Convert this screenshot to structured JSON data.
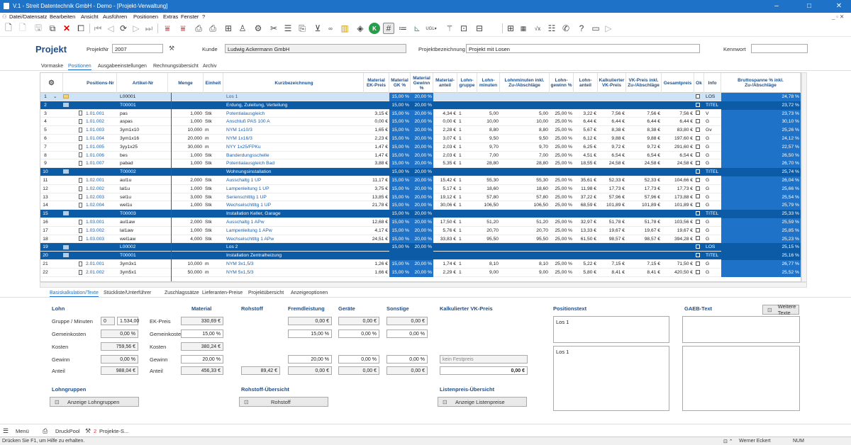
{
  "window": {
    "title": "V.1 - Streit Datentechnik GmbH - Demo - [Projekt-Verwaltung]",
    "controls": [
      "–",
      "□",
      "✕"
    ],
    "mdi_controls": "_ ▫ ✕"
  },
  "menu": [
    "Datei/Datensatz",
    "Bearbeiten",
    "Ansicht",
    "Ausführen",
    "Positionen",
    "Extras",
    "Fenster",
    "?"
  ],
  "header": {
    "title": "Projekt",
    "projektnr_label": "ProjektNr",
    "projektnr_value": "2007",
    "kunde_label": "Kunde",
    "kunde_value": "Ludwig Ackermann GmbH",
    "bezeichnung_label": "Projektbezeichnung",
    "bezeichnung_value": "Projekt mit Losen",
    "kennwort_label": "Kennwort",
    "kennwort_value": ""
  },
  "tabs1": [
    "Vormaske",
    "Positionen",
    "Ausgabeeinstellungen",
    "Rechnungsübersicht",
    "Archiv"
  ],
  "grid": {
    "headers": [
      "Positions-Nr",
      "Artikel-Nr",
      "Menge",
      "Einheit",
      "Kurzbezeichnung",
      "Material EK-Preis",
      "Material GK %",
      "Material Gewinn %",
      "Material-anteil",
      "Lohn-gruppe",
      "Lohn-minuten",
      "Lohnminuten inkl. Zu-/Abschläge",
      "Lohn-gewinn %",
      "Lohn-anteil",
      "Kalkulierter VK-Preis",
      "VK-Preis inkl. Zu-/Abschläge",
      "Gesamtpreis",
      "Ok",
      "Info",
      "Bruttospanne % inkl. Zu-/Abschläge"
    ],
    "rows": [
      {
        "n": "1",
        "type": "sel",
        "pos": "",
        "art": "L00001",
        "menge": "",
        "einh": "",
        "kurz": "Los 1",
        "mek": "",
        "mgk": "15,00 %",
        "mgw": "20,00 %",
        "mant": "",
        "lg": "",
        "lmin": "",
        "lminz": "",
        "lgw": "",
        "lant": "",
        "kvk": "",
        "vkz": "",
        "ges": "",
        "ok": "☑",
        "info": "LOS",
        "bs": "24,78 %"
      },
      {
        "n": "2",
        "type": "title",
        "pos": "",
        "art": "T00001",
        "menge": "",
        "einh": "",
        "kurz": "Erdung, Zuleitung, Verteilung",
        "mek": "",
        "mgk": "15,00 %",
        "mgw": "20,00 %",
        "mant": "",
        "lg": "",
        "lmin": "",
        "lminz": "",
        "lgw": "",
        "lant": "",
        "kvk": "",
        "vkz": "",
        "ges": "",
        "ok": "☑",
        "info": "TITEL",
        "bs": "23,72 %"
      },
      {
        "n": "3",
        "type": "item",
        "pos": "1.01.001",
        "art": "pas",
        "menge": "1,000",
        "einh": "Stk",
        "kurz": "Potentialausgleich",
        "mek": "3,15 €",
        "mgk": "15,00 %",
        "mgw": "20,00 %",
        "mant": "4,34 €",
        "lg": "1",
        "lmin": "5,00",
        "lminz": "5,00",
        "lgw": "25,00 %",
        "lant": "3,22 €",
        "kvk": "7,56 €",
        "vkz": "7,56 €",
        "ges": "7,56 €",
        "ok": "☑",
        "info": "V",
        "bs": "23,73 %"
      },
      {
        "n": "4",
        "type": "item",
        "pos": "1.01.002",
        "art": "aspas",
        "menge": "1,000",
        "einh": "Stk",
        "kurz": "Anschluß PAS 100 A",
        "mek": "0,00 €",
        "mgk": "15,00 %",
        "mgw": "20,00 %",
        "mant": "0,00 €",
        "lg": "1",
        "lmin": "10,00",
        "lminz": "10,00",
        "lgw": "25,00 %",
        "lant": "6,44 €",
        "kvk": "6,44 €",
        "vkz": "6,44 €",
        "ges": "6,44 €",
        "ok": "☑",
        "info": "G",
        "bs": "30,10 %"
      },
      {
        "n": "5",
        "type": "item",
        "pos": "1.01.003",
        "art": "3ym1x10",
        "menge": "10,000",
        "einh": "m",
        "kurz": "NYM 1x10/3",
        "mek": "1,65 €",
        "mgk": "15,00 %",
        "mgw": "20,00 %",
        "mant": "2,28 €",
        "lg": "1",
        "lmin": "8,80",
        "lminz": "8,80",
        "lgw": "25,00 %",
        "lant": "5,67 €",
        "kvk": "8,38 €",
        "vkz": "8,38 €",
        "ges": "83,80 €",
        "ok": "☑",
        "info": "Gv",
        "bs": "25,26 %"
      },
      {
        "n": "6",
        "type": "item",
        "pos": "1.01.004",
        "art": "3ym1x16",
        "menge": "20,000",
        "einh": "m",
        "kurz": "NYM 1x16/3",
        "mek": "2,23 €",
        "mgk": "15,00 %",
        "mgw": "20,00 %",
        "mant": "3,07 €",
        "lg": "1",
        "lmin": "9,50",
        "lminz": "9,50",
        "lgw": "25,00 %",
        "lant": "6,12 €",
        "kvk": "9,88 €",
        "vkz": "9,88 €",
        "ges": "197,60 €",
        "ok": "☑",
        "info": "G",
        "bs": "24,12 %"
      },
      {
        "n": "7",
        "type": "item",
        "pos": "1.01.005",
        "art": "3yy1x25",
        "menge": "30,000",
        "einh": "m",
        "kurz": "NYY 1x25/FPKu",
        "mek": "1,47 €",
        "mgk": "15,00 %",
        "mgw": "20,00 %",
        "mant": "2,03 €",
        "lg": "1",
        "lmin": "9,70",
        "lminz": "9,70",
        "lgw": "25,00 %",
        "lant": "6,25 €",
        "kvk": "9,72 €",
        "vkz": "9,72 €",
        "ges": "291,60 €",
        "ok": "☑",
        "info": "G",
        "bs": "22,57 %"
      },
      {
        "n": "8",
        "type": "item",
        "pos": "1.01.006",
        "art": "bes",
        "menge": "1,000",
        "einh": "Stk",
        "kurz": "Banderdungsschelle",
        "mek": "1,47 €",
        "mgk": "15,00 %",
        "mgw": "20,00 %",
        "mant": "2,03 €",
        "lg": "1",
        "lmin": "7,00",
        "lminz": "7,00",
        "lgw": "25,00 %",
        "lant": "4,51 €",
        "kvk": "6,54 €",
        "vkz": "6,54 €",
        "ges": "6,54 €",
        "ok": "☑",
        "info": "G",
        "bs": "26,50 %"
      },
      {
        "n": "9",
        "type": "item",
        "pos": "1.01.007",
        "art": "pabad",
        "menge": "1,000",
        "einh": "Stk",
        "kurz": "Potentialausgleich Bad",
        "mek": "3,88 €",
        "mgk": "15,00 %",
        "mgw": "20,00 %",
        "mant": "5,35 €",
        "lg": "1",
        "lmin": "28,80",
        "lminz": "28,80",
        "lgw": "25,00 %",
        "lant": "18,55 €",
        "kvk": "24,58 €",
        "vkz": "24,58 €",
        "ges": "24,58 €",
        "ok": "☑",
        "info": "G",
        "bs": "26,70 %"
      },
      {
        "n": "10",
        "type": "title",
        "pos": "",
        "art": "T00002",
        "menge": "",
        "einh": "",
        "kurz": "Wohnungsinstallation",
        "mek": "",
        "mgk": "15,00 %",
        "mgw": "20,00 %",
        "mant": "",
        "lg": "",
        "lmin": "",
        "lminz": "",
        "lgw": "",
        "lant": "",
        "kvk": "",
        "vkz": "",
        "ges": "",
        "ok": "☑",
        "info": "TITEL",
        "bs": "25,74 %"
      },
      {
        "n": "11",
        "type": "item",
        "pos": "1.02.001",
        "art": "aul1u",
        "menge": "2,000",
        "einh": "Stk",
        "kurz": "Ausschaltg 1 UP",
        "mek": "11,17 €",
        "mgk": "15,00 %",
        "mgw": "20,00 %",
        "mant": "15,42 €",
        "lg": "1",
        "lmin": "55,30",
        "lminz": "55,30",
        "lgw": "25,00 %",
        "lant": "35,61 €",
        "kvk": "52,33 €",
        "vkz": "52,33 €",
        "ges": "104,66 €",
        "ok": "☑",
        "info": "G",
        "bs": "26,04 %"
      },
      {
        "n": "12",
        "type": "item",
        "pos": "1.02.002",
        "art": "lal1u",
        "menge": "1,000",
        "einh": "Stk",
        "kurz": "Lampenleitung 1 UP",
        "mek": "3,75 €",
        "mgk": "15,00 %",
        "mgw": "20,00 %",
        "mant": "5,17 €",
        "lg": "1",
        "lmin": "18,60",
        "lminz": "18,60",
        "lgw": "25,00 %",
        "lant": "11,98 €",
        "kvk": "17,73 €",
        "vkz": "17,73 €",
        "ges": "17,73 €",
        "ok": "☑",
        "info": "G",
        "bs": "25,66 %"
      },
      {
        "n": "13",
        "type": "item",
        "pos": "1.02.003",
        "art": "sel1u",
        "menge": "3,000",
        "einh": "Stk",
        "kurz": "Serienschltltg 1 UP",
        "mek": "13,85 €",
        "mgk": "15,00 %",
        "mgw": "20,00 %",
        "mant": "19,12 €",
        "lg": "1",
        "lmin": "57,80",
        "lminz": "57,80",
        "lgw": "25,00 %",
        "lant": "37,22 €",
        "kvk": "57,96 €",
        "vkz": "57,96 €",
        "ges": "173,88 €",
        "ok": "☑",
        "info": "G",
        "bs": "25,54 %"
      },
      {
        "n": "14",
        "type": "item",
        "pos": "1.02.004",
        "art": "wel1u",
        "menge": "1,000",
        "einh": "Stk",
        "kurz": "Wechselschltltg 1 UP",
        "mek": "21,78 €",
        "mgk": "15,00 %",
        "mgw": "20,00 %",
        "mant": "30,06 €",
        "lg": "1",
        "lmin": "106,50",
        "lminz": "106,50",
        "lgw": "25,00 %",
        "lant": "68,59 €",
        "kvk": "101,89 €",
        "vkz": "101,89 €",
        "ges": "101,89 €",
        "ok": "☑",
        "info": "G",
        "bs": "25,79 %"
      },
      {
        "n": "15",
        "type": "title",
        "pos": "",
        "art": "T00003",
        "menge": "",
        "einh": "",
        "kurz": "Installation Keller, Garage",
        "mek": "",
        "mgk": "15,00 %",
        "mgw": "20,00 %",
        "mant": "",
        "lg": "",
        "lmin": "",
        "lminz": "",
        "lgw": "",
        "lant": "",
        "kvk": "",
        "vkz": "",
        "ges": "",
        "ok": "☑",
        "info": "TITEL",
        "bs": "25,33 %"
      },
      {
        "n": "16",
        "type": "item",
        "pos": "1.03.001",
        "art": "aul1aw",
        "menge": "2,000",
        "einh": "Stk",
        "kurz": "Ausschaltg 1 APw",
        "mek": "12,68 €",
        "mgk": "15,00 %",
        "mgw": "20,00 %",
        "mant": "17,50 €",
        "lg": "1",
        "lmin": "51,20",
        "lminz": "51,20",
        "lgw": "25,00 %",
        "lant": "32,97 €",
        "kvk": "51,78 €",
        "vkz": "51,78 €",
        "ges": "103,56 €",
        "ok": "☑",
        "info": "G",
        "bs": "25,59 %"
      },
      {
        "n": "17",
        "type": "item",
        "pos": "1.03.002",
        "art": "lal1aw",
        "menge": "1,000",
        "einh": "Stk",
        "kurz": "Lampenleitung 1 APw",
        "mek": "4,17 €",
        "mgk": "15,00 %",
        "mgw": "20,00 %",
        "mant": "5,76 €",
        "lg": "1",
        "lmin": "20,70",
        "lminz": "20,70",
        "lgw": "25,00 %",
        "lant": "13,33 €",
        "kvk": "19,67 €",
        "vkz": "19,67 €",
        "ges": "19,67 €",
        "ok": "☑",
        "info": "G",
        "bs": "25,85 %"
      },
      {
        "n": "18",
        "type": "item",
        "pos": "1.03.003",
        "art": "wel1aw",
        "menge": "4,000",
        "einh": "Stk",
        "kurz": "Wechselschltltg 1 APw",
        "mek": "24,51 €",
        "mgk": "15,00 %",
        "mgw": "20,00 %",
        "mant": "33,83 €",
        "lg": "1",
        "lmin": "95,50",
        "lminz": "95,50",
        "lgw": "25,00 %",
        "lant": "61,50 €",
        "kvk": "98,57 €",
        "vkz": "98,57 €",
        "ges": "394,28 €",
        "ok": "☑",
        "info": "G",
        "bs": "25,23 %"
      },
      {
        "n": "19",
        "type": "title",
        "pos": "",
        "art": "L00002",
        "menge": "",
        "einh": "",
        "kurz": "Los 2",
        "mek": "",
        "mgk": "15,00 %",
        "mgw": "20,00 %",
        "mant": "",
        "lg": "",
        "lmin": "",
        "lminz": "",
        "lgw": "",
        "lant": "",
        "kvk": "",
        "vkz": "",
        "ges": "",
        "ok": "☑",
        "info": "LOS",
        "bs": "25,15 %"
      },
      {
        "n": "20",
        "type": "title",
        "pos": "",
        "art": "T00001",
        "menge": "",
        "einh": "",
        "kurz": "Installation Zentralheizung",
        "mek": "",
        "mgk": "",
        "mgw": "",
        "mant": "",
        "lg": "",
        "lmin": "",
        "lminz": "",
        "lgw": "",
        "lant": "",
        "kvk": "",
        "vkz": "",
        "ges": "",
        "ok": "☑",
        "info": "TITEL",
        "bs": "25,16 %"
      },
      {
        "n": "21",
        "type": "item",
        "pos": "2.01.001",
        "art": "3ym3x1",
        "menge": "10,000",
        "einh": "m",
        "kurz": "NYM 3x1,5/3",
        "mek": "1,26 €",
        "mgk": "15,00 %",
        "mgw": "20,00 %",
        "mant": "1,74 €",
        "lg": "1",
        "lmin": "8,10",
        "lminz": "8,10",
        "lgw": "25,00 %",
        "lant": "5,22 €",
        "kvk": "7,15 €",
        "vkz": "7,15 €",
        "ges": "71,50 €",
        "ok": "☑",
        "info": "G",
        "bs": "26,77 %"
      },
      {
        "n": "22",
        "type": "item",
        "pos": "2.01.002",
        "art": "3ym5x1",
        "menge": "50,000",
        "einh": "m",
        "kurz": "NYM 5x1,5/3",
        "mek": "1,66 €",
        "mgk": "15,00 %",
        "mgw": "20,00 %",
        "mant": "2,29 €",
        "lg": "1",
        "lmin": "9,00",
        "lminz": "9,00",
        "lgw": "25,00 %",
        "lant": "5,80 €",
        "kvk": "8,41 €",
        "vkz": "8,41 €",
        "ges": "420,50 €",
        "ok": "☑",
        "info": "G",
        "bs": "25,52 %"
      }
    ]
  },
  "tabs2": [
    "Basiskalkulation/Texte",
    "Stückliste/Unterführer",
    "Zuschlagssätze",
    "Lieferanten-Preise",
    "Projektübersicht",
    "Anzeigeoptionen"
  ],
  "bottom": {
    "lohn": "Lohn",
    "material": "Material",
    "rohstoff": "Rohstoff",
    "fremd": "Fremdleistung",
    "geraete": "Geräte",
    "sonstige": "Sonstige",
    "kvk": "Kalkulierter VK-Preis",
    "postext": "Positionstext",
    "gaeb": "GAEB-Text",
    "weitere": "Weitere Texte",
    "gruppe_label": "Gruppe / Minuten",
    "gruppe": "0",
    "minuten": "1.534,00",
    "gemein_label": "Gemeinkosten",
    "lohn_gk": "0,00 %",
    "kosten_label": "Kosten",
    "lohn_kosten": "759,56 €",
    "gewinn_label": "Gewinn",
    "lohn_gewinn": "0,00 %",
    "anteil_label": "Anteil",
    "lohn_anteil": "988,04 €",
    "ek_label": "EK-Preis",
    "mat_ek": "330,69 €",
    "mat_gk": "15,00 %",
    "mat_kosten": "380,24 €",
    "mat_gewinn": "20,00 %",
    "mat_anteil": "456,33 €",
    "roh_anteil": "89,42 €",
    "fl_ek": "0,00 €",
    "fl_gk": "15,00 %",
    "fl_gewinn": "20,00 %",
    "fl_anteil": "0,00 €",
    "ge_ek": "0,00 €",
    "ge_gk": "0,00 %",
    "ge_gewinn": "0,00 %",
    "ge_anteil": "0,00 €",
    "so_ek": "0,00 €",
    "so_gk": "0,00 %",
    "so_gewinn": "0,00 %",
    "so_anteil": "0,00 €",
    "festpreis": "kein Festpreis",
    "vk_total": "0,00 €",
    "postext1": "Los 1",
    "postext2": "Los 1",
    "lohngruppen": "Lohngruppen",
    "btn_lohngruppen": "Anzeige Lohngruppen",
    "rohstoff_ueb": "Rohstoff-Übersicht",
    "btn_rohstoff": "Rohstoff",
    "listenpreis": "Listenpreis-Übersicht",
    "btn_listenpreise": "Anzeige Listenpreise"
  },
  "taskbar": {
    "menu": "Menü",
    "druckpool": "DruckPool",
    "count": "2",
    "projekte": "Projekte-S..."
  },
  "status": {
    "hint": "Drücken Sie F1, um Hilfe zu erhalten.",
    "user": "Werner Eckert",
    "num": "NUM"
  }
}
